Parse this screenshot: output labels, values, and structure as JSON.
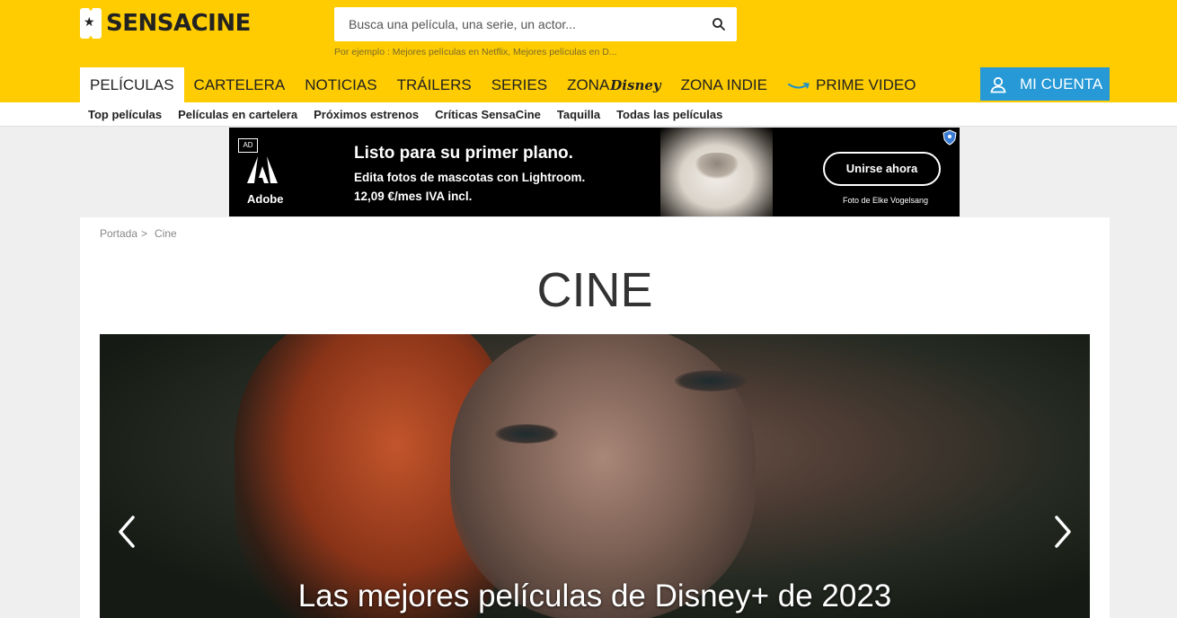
{
  "header": {
    "logo_text": "SENSACINE",
    "search": {
      "placeholder": "Busca una película, una serie, un actor...",
      "hint": "Por ejemplo : Mejores películas en Netflix, Mejores películas en D..."
    },
    "nav": [
      {
        "label": "PELÍCULAS",
        "active": true
      },
      {
        "label": "CARTELERA",
        "active": false
      },
      {
        "label": "NOTICIAS",
        "active": false
      },
      {
        "label": "TRÁILERS",
        "active": false
      },
      {
        "label": "SERIES",
        "active": false
      }
    ],
    "zona_disney": {
      "zona": "ZONA",
      "disney": "Disney"
    },
    "zona_indie": "ZONA INDIE",
    "prime_video": "PRIME VIDEO",
    "account_label": "MI CUENTA"
  },
  "subnav": [
    "Top películas",
    "Películas en cartelera",
    "Próximos estrenos",
    "Críticas SensaCine",
    "Taquilla",
    "Todas las películas"
  ],
  "ad": {
    "tag": "AD",
    "brand": "Adobe",
    "headline": "Listo para su primer plano.",
    "line1": "Edita fotos de mascotas con Lightroom.",
    "line2": "12,09 €/mes IVA incl.",
    "cta": "Unirse ahora",
    "credit": "Foto de Elke Vogelsang"
  },
  "breadcrumb": {
    "home": "Portada",
    "separator": ">",
    "current": "Cine"
  },
  "page_title": "CINE",
  "hero": {
    "caption": "Las mejores películas de Disney+ de 2023"
  },
  "colors": {
    "brand_yellow": "#fecc00",
    "account_blue": "#2699d6"
  }
}
